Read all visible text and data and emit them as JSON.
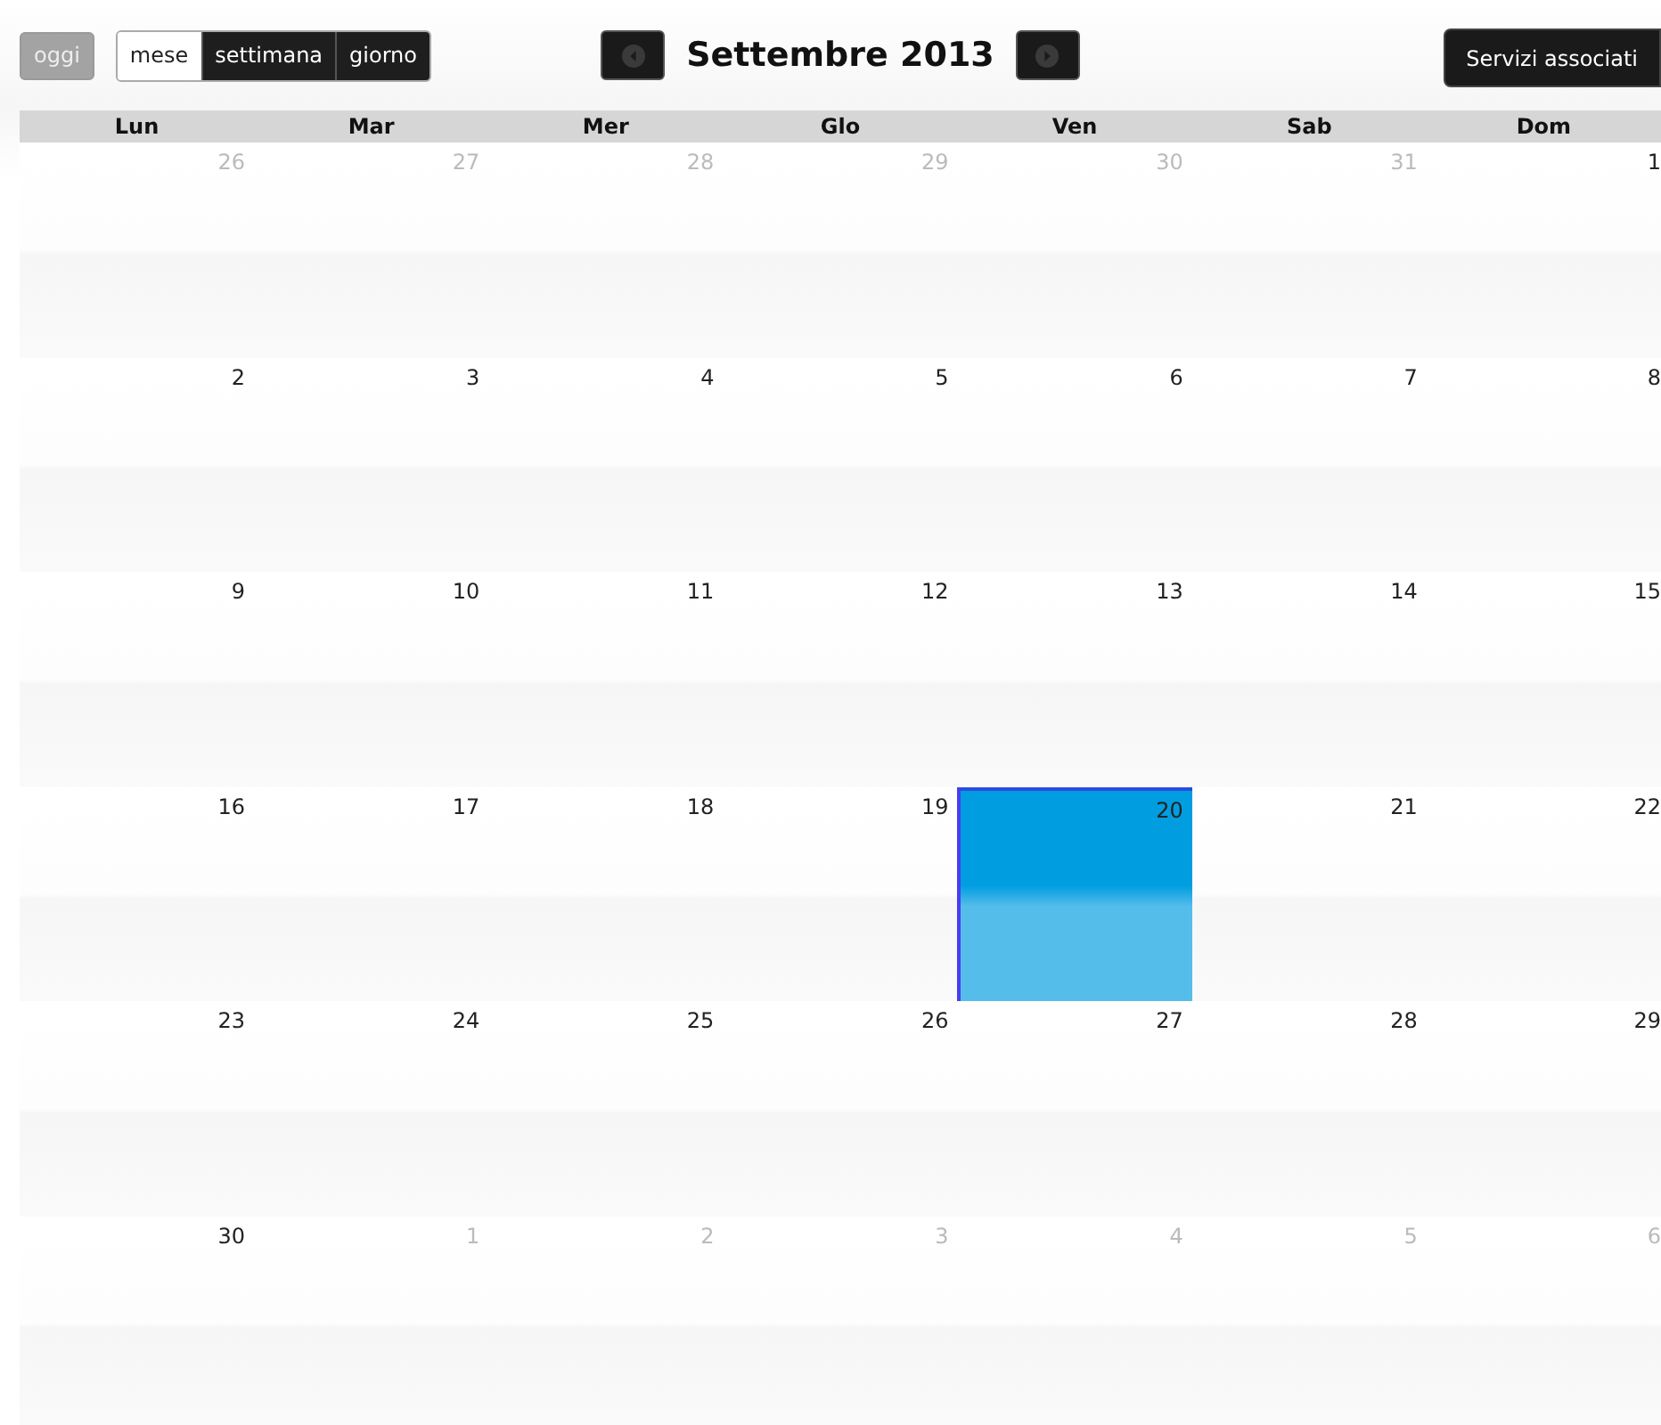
{
  "toolbar": {
    "today": "oggi",
    "views": [
      {
        "label": "mese",
        "selected": true
      },
      {
        "label": "settimana",
        "selected": false
      },
      {
        "label": "giorno",
        "selected": false
      }
    ],
    "title": "Settembre 2013",
    "action": "Servizi associati"
  },
  "weekdays": [
    "Lun",
    "Mar",
    "Mer",
    "Glo",
    "Ven",
    "Sab",
    "Dom"
  ],
  "weeks": [
    [
      {
        "day": "26",
        "other_month": true,
        "selected": false
      },
      {
        "day": "27",
        "other_month": true,
        "selected": false
      },
      {
        "day": "28",
        "other_month": true,
        "selected": false
      },
      {
        "day": "29",
        "other_month": true,
        "selected": false
      },
      {
        "day": "30",
        "other_month": true,
        "selected": false
      },
      {
        "day": "31",
        "other_month": true,
        "selected": false
      },
      {
        "day": "1",
        "other_month": false,
        "selected": false
      }
    ],
    [
      {
        "day": "2",
        "other_month": false,
        "selected": false
      },
      {
        "day": "3",
        "other_month": false,
        "selected": false
      },
      {
        "day": "4",
        "other_month": false,
        "selected": false
      },
      {
        "day": "5",
        "other_month": false,
        "selected": false
      },
      {
        "day": "6",
        "other_month": false,
        "selected": false
      },
      {
        "day": "7",
        "other_month": false,
        "selected": false
      },
      {
        "day": "8",
        "other_month": false,
        "selected": false
      }
    ],
    [
      {
        "day": "9",
        "other_month": false,
        "selected": false
      },
      {
        "day": "10",
        "other_month": false,
        "selected": false
      },
      {
        "day": "11",
        "other_month": false,
        "selected": false
      },
      {
        "day": "12",
        "other_month": false,
        "selected": false
      },
      {
        "day": "13",
        "other_month": false,
        "selected": false
      },
      {
        "day": "14",
        "other_month": false,
        "selected": false
      },
      {
        "day": "15",
        "other_month": false,
        "selected": false
      }
    ],
    [
      {
        "day": "16",
        "other_month": false,
        "selected": false
      },
      {
        "day": "17",
        "other_month": false,
        "selected": false
      },
      {
        "day": "18",
        "other_month": false,
        "selected": false
      },
      {
        "day": "19",
        "other_month": false,
        "selected": false
      },
      {
        "day": "20",
        "other_month": false,
        "selected": true
      },
      {
        "day": "21",
        "other_month": false,
        "selected": false
      },
      {
        "day": "22",
        "other_month": false,
        "selected": false
      }
    ],
    [
      {
        "day": "23",
        "other_month": false,
        "selected": false
      },
      {
        "day": "24",
        "other_month": false,
        "selected": false
      },
      {
        "day": "25",
        "other_month": false,
        "selected": false
      },
      {
        "day": "26",
        "other_month": false,
        "selected": false
      },
      {
        "day": "27",
        "other_month": false,
        "selected": false
      },
      {
        "day": "28",
        "other_month": false,
        "selected": false
      },
      {
        "day": "29",
        "other_month": false,
        "selected": false
      }
    ],
    [
      {
        "day": "30",
        "other_month": false,
        "selected": false
      },
      {
        "day": "1",
        "other_month": true,
        "selected": false
      },
      {
        "day": "2",
        "other_month": true,
        "selected": false
      },
      {
        "day": "3",
        "other_month": true,
        "selected": false
      },
      {
        "day": "4",
        "other_month": true,
        "selected": false
      },
      {
        "day": "5",
        "other_month": true,
        "selected": false
      },
      {
        "day": "6",
        "other_month": true,
        "selected": false
      }
    ]
  ]
}
